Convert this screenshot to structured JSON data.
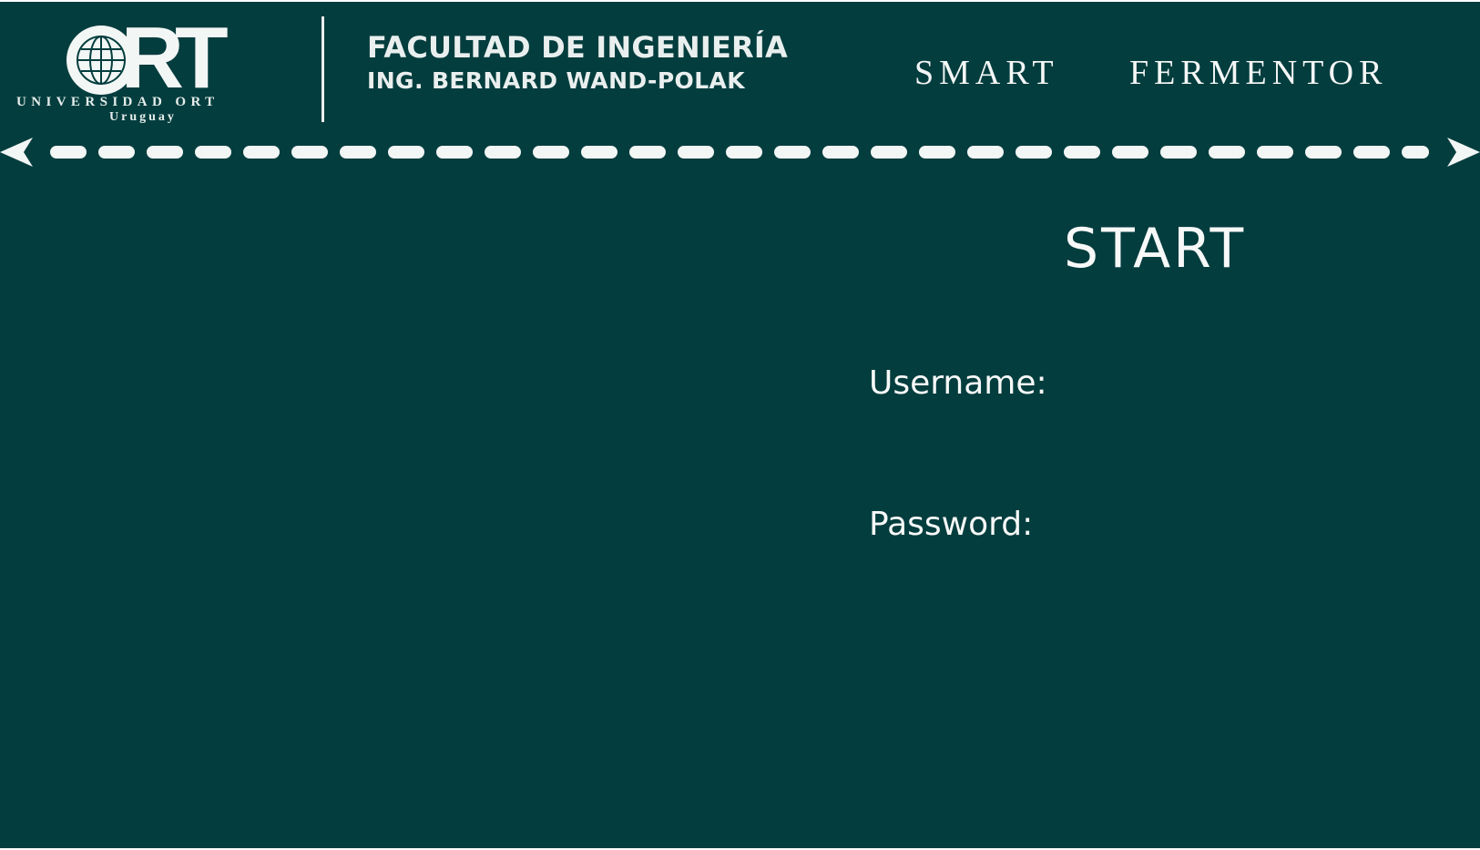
{
  "logo": {
    "wordmark": "ORT",
    "institution": "UNIVERSIDAD ORT",
    "country": "Uruguay"
  },
  "faculty": {
    "line1": "FACULTAD DE INGENIERÍA",
    "line2": "ING. BERNARD WAND-POLAK"
  },
  "brand": {
    "word1": "SMART",
    "word2": "FERMENTOR"
  },
  "login": {
    "title": "START",
    "username_label": "Username:",
    "username_value": "",
    "password_label": "Password:",
    "password_value": ""
  },
  "colors": {
    "background": "#043d3e",
    "foreground": "#f7f9f8"
  },
  "icons": {
    "globe": "globe-icon",
    "double_arrow": "double-headed-dashed-arrow-icon"
  }
}
